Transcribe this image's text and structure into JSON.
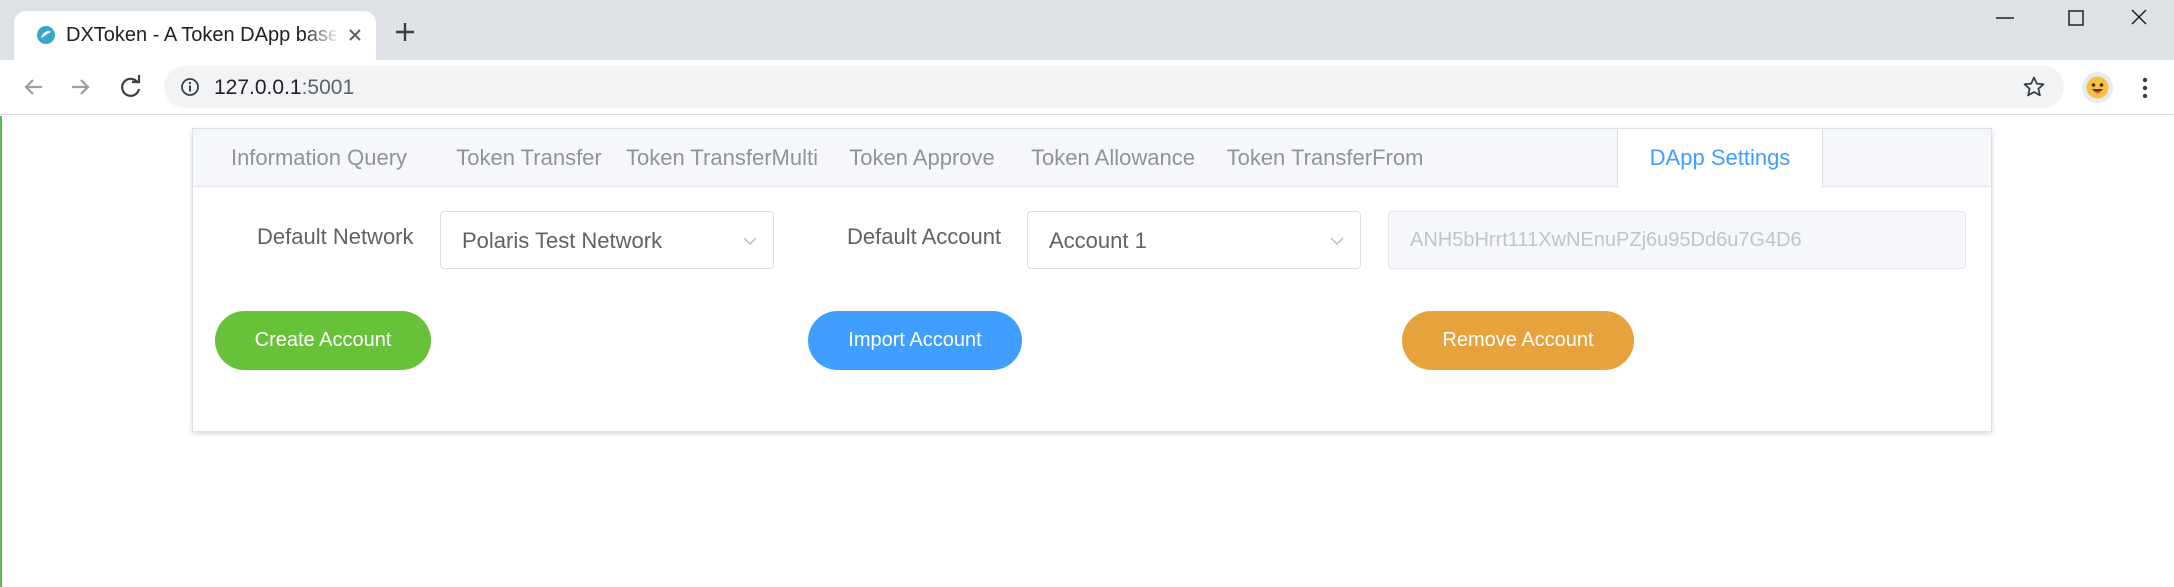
{
  "browser": {
    "tab_title": "DXToken - A Token DApp based on NEO",
    "url_host": "127.0.0.1",
    "url_port": ":5001"
  },
  "app": {
    "tabs": [
      {
        "label": "Information Query"
      },
      {
        "label": "Token Transfer"
      },
      {
        "label": "Token TransferMulti"
      },
      {
        "label": "Token Approve"
      },
      {
        "label": "Token Allowance"
      },
      {
        "label": "Token TransferFrom"
      },
      {
        "label": "DApp Settings"
      }
    ],
    "active_tab": "DApp Settings",
    "settings": {
      "network_label": "Default Network",
      "network_value": "Polaris Test Network",
      "account_label": "Default Account",
      "account_value": "Account 1",
      "address_value": "ANH5bHrrt111XwNEnuPZj6u95Dd6u7G4D6"
    },
    "buttons": {
      "create": "Create Account",
      "import": "Import Account",
      "remove": "Remove Account"
    },
    "colors": {
      "active_tab": "#409eff",
      "create_button": "#67c23a",
      "import_button": "#409eff",
      "remove_button": "#e6a23c"
    }
  }
}
